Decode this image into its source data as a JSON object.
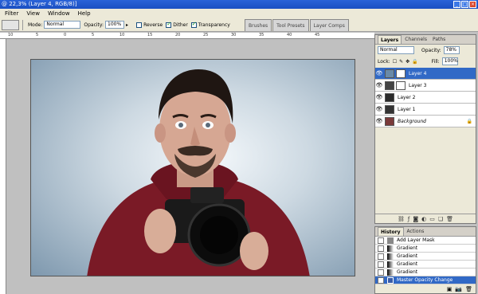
{
  "window": {
    "title": "@ 22,3% (Layer 4, RGB/8)]"
  },
  "menu": {
    "items": [
      "Filter",
      "View",
      "Window",
      "Help"
    ]
  },
  "options": {
    "mode_label": "Mode:",
    "mode_value": "Normal",
    "opacity_label": "Opacity:",
    "opacity_value": "100%",
    "reverse_label": "Reverse",
    "dither_label": "Dither",
    "transparency_label": "Transparency"
  },
  "dock_tabs": [
    "Brushes",
    "Tool Presets",
    "Layer Comps"
  ],
  "ruler": {
    "h_labels": [
      "10",
      "5",
      "0",
      "5",
      "10",
      "15",
      "20",
      "25",
      "30",
      "35",
      "40",
      "45"
    ]
  },
  "layers_panel": {
    "tabs": [
      "Layers",
      "Channels",
      "Paths"
    ],
    "blend_mode": "Normal",
    "opacity_label": "Opacity:",
    "opacity_value": "78%",
    "lock_label": "Lock:",
    "fill_label": "Fill:",
    "fill_value": "100%",
    "layers": [
      {
        "name": "Layer 4",
        "selected": true
      },
      {
        "name": "Layer 3",
        "selected": false
      },
      {
        "name": "Layer 2",
        "selected": false
      },
      {
        "name": "Layer 1",
        "selected": false
      },
      {
        "name": "Background",
        "selected": false
      }
    ]
  },
  "history_panel": {
    "tabs": [
      "History",
      "Actions"
    ],
    "items": [
      {
        "label": "Add Layer Mask",
        "selected": false
      },
      {
        "label": "Gradient",
        "selected": false
      },
      {
        "label": "Gradient",
        "selected": false
      },
      {
        "label": "Gradient",
        "selected": false
      },
      {
        "label": "Gradient",
        "selected": false
      },
      {
        "label": "Master Opacity Change",
        "selected": true
      }
    ]
  }
}
